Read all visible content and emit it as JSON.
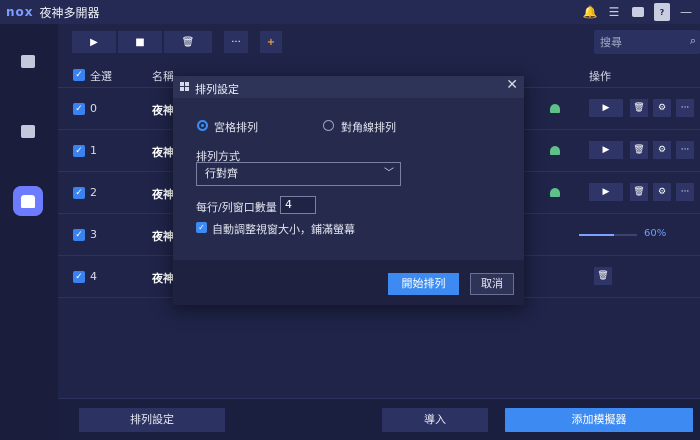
{
  "app": {
    "logo": "nox",
    "title": "夜神多開器"
  },
  "titlebar_icons": [
    "bell-icon",
    "menu-icon",
    "folder-icon",
    "help-icon",
    "minimize-icon"
  ],
  "titlebar_glyphs": {
    "help": "?"
  },
  "toolbar": {
    "play": "▶",
    "stop": "■",
    "delete": "🗑",
    "more": "···",
    "folder": "+"
  },
  "search": {
    "placeholder": "搜尋",
    "icon": "⌕"
  },
  "table": {
    "select_all": "全選",
    "col_name": "名稱",
    "col_action": "操作",
    "rows": [
      {
        "index": "0",
        "name": "夜神",
        "status": "stopped"
      },
      {
        "index": "1",
        "name": "夜神",
        "status": "stopped"
      },
      {
        "index": "2",
        "name": "夜神",
        "status": "stopped"
      },
      {
        "index": "3",
        "name": "夜神",
        "status": "loading",
        "progress": "60%",
        "progress_value": 60
      },
      {
        "index": "4",
        "name": "夜神",
        "status": "deleting"
      }
    ],
    "action_glyphs": {
      "play": "▶",
      "delete": "🗑",
      "settings": "⚙",
      "more": "···"
    }
  },
  "bottom": {
    "arrange": "排列設定",
    "import": "導入",
    "add": "添加模擬器"
  },
  "modal": {
    "title": "排列設定",
    "close": "✕",
    "grid_option": "宮格排列",
    "diagonal_option": "對角線排列",
    "arrange_mode_label": "排列方式",
    "arrange_mode_value": "行對齊",
    "per_row_label": "每行/列窗口數量",
    "per_row_value": "4",
    "auto_resize_label": "自動調整視窗大小，鋪滿螢幕",
    "start_button": "開始排列",
    "cancel_button": "取消"
  },
  "colors": {
    "accent": "#3d8bf2",
    "sidebar_active": "#6d7cff",
    "android": "#5fc18a",
    "background": "#1f2448"
  }
}
